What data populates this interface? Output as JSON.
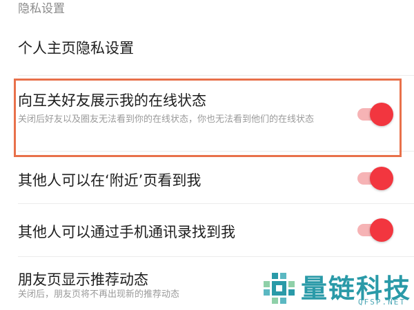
{
  "section": {
    "title": "隐私设置"
  },
  "rows": [
    {
      "title": "个人主页隐私设置"
    },
    {
      "title": "向互关好友展示我的在线状态",
      "subtitle": "关闭后好友以及圈友无法看到你的在线状态，你也无法看到他们的在线状态",
      "enabled": true
    },
    {
      "title": "其他人可以在‘附近’页看到我",
      "enabled": true
    },
    {
      "title": "其他人可以通过手机通讯录找到我",
      "enabled": true
    },
    {
      "title": "朋友页显示推荐动态",
      "subtitle": "关闭后，朋友页将不再出现新的推荐动态"
    }
  ],
  "colors": {
    "toggle_on": "#f2363f",
    "toggle_track_on": "#f6b3b5",
    "highlight": "#e8704a",
    "watermark": "#2a9aa8"
  },
  "watermark": {
    "name": "量链科技",
    "sub": "QFSP.NET"
  }
}
